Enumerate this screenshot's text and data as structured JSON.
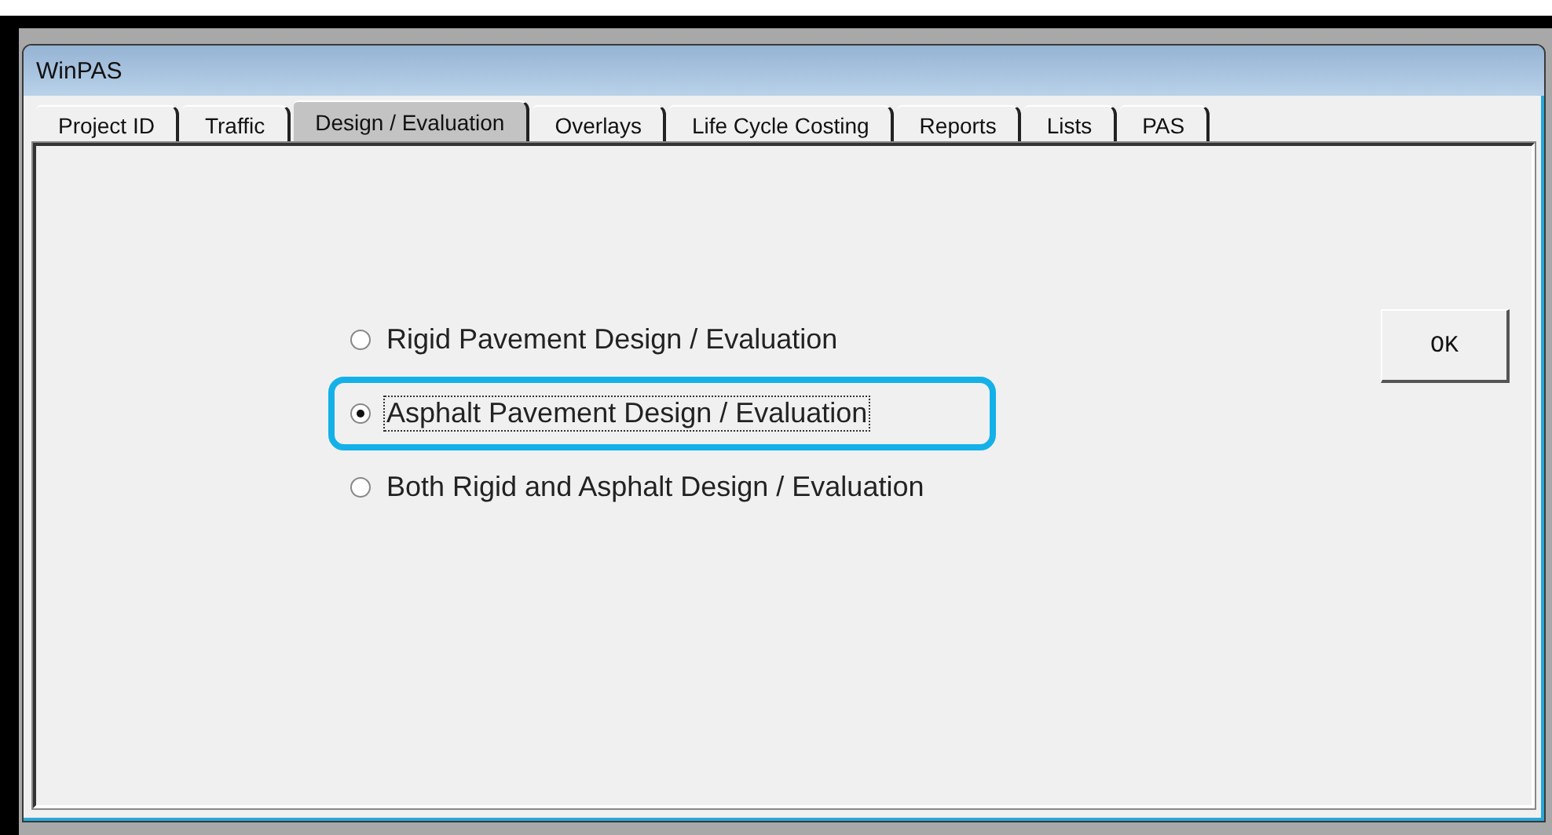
{
  "window": {
    "title": "WinPAS"
  },
  "tabs": [
    {
      "label": "Project ID",
      "selected": false
    },
    {
      "label": "Traffic",
      "selected": false
    },
    {
      "label": "Design / Evaluation",
      "selected": true
    },
    {
      "label": "Overlays",
      "selected": false
    },
    {
      "label": "Life Cycle Costing",
      "selected": false
    },
    {
      "label": "Reports",
      "selected": false
    },
    {
      "label": "Lists",
      "selected": false
    },
    {
      "label": "PAS",
      "selected": false
    }
  ],
  "options": [
    {
      "label": "Rigid Pavement Design / Evaluation",
      "selected": false,
      "highlighted": false
    },
    {
      "label": "Asphalt Pavement Design / Evaluation",
      "selected": true,
      "highlighted": true
    },
    {
      "label": "Both Rigid and Asphalt Design / Evaluation",
      "selected": false,
      "highlighted": false
    }
  ],
  "buttons": [
    {
      "label": "OK"
    }
  ]
}
